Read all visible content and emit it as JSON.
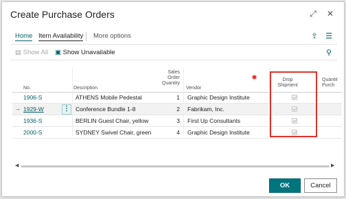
{
  "dialog": {
    "title": "Create Purchase Orders",
    "expand_icon": "expand-icon",
    "close_icon": "close-icon"
  },
  "actions": {
    "home": "Home",
    "item_availability": "Item Availability",
    "more_options": "More options"
  },
  "toolbar": {
    "show_all": "Show All",
    "show_unavailable": "Show Unavailable"
  },
  "columns": {
    "no": "No.",
    "description": "Description",
    "sales_qty_1": "Sales",
    "sales_qty_2": "Order",
    "sales_qty_3": "Quantity",
    "vendor": "Vendor",
    "drop_1": "Drop",
    "drop_2": "Shipment",
    "qty_purch_1": "Quantit",
    "qty_purch_2": "Purch"
  },
  "rows": [
    {
      "no": "1906-S",
      "description": "ATHENS Mobile Pedestal",
      "qty": "1",
      "vendor": "Graphic Design Institute",
      "drop_shipment": true
    },
    {
      "no": "1929-W",
      "description": "Conference Bundle 1-8",
      "qty": "2",
      "vendor": "Fabrikam, Inc.",
      "drop_shipment": true
    },
    {
      "no": "1936-S",
      "description": "BERLIN Guest Chair, yellow",
      "qty": "3",
      "vendor": "First Up Consultants",
      "drop_shipment": true
    },
    {
      "no": "2000-S",
      "description": "SYDNEY Swivel Chair, green",
      "qty": "4",
      "vendor": "Graphic Design Institute",
      "drop_shipment": true
    }
  ],
  "row_marker": "→",
  "ellipsis": "⋮",
  "footer": {
    "ok": "OK",
    "cancel": "Cancel"
  },
  "colors": {
    "accent": "#00757e",
    "highlight": "#e0302a"
  }
}
